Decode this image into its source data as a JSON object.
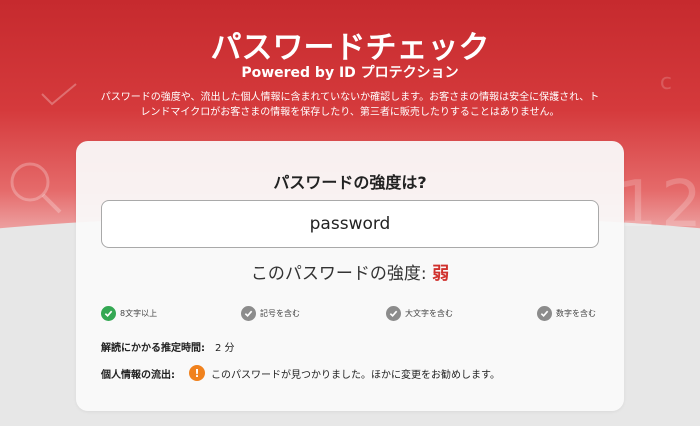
{
  "page": {
    "title": "パスワードチェック",
    "subtitle": "Powered by ID プロテクション",
    "description": "パスワードの強度や、流出した個人情報に含まれていないか確認します。お客さまの情報は安全に保護され、トレンドマイクロがお客さまの情報を保存したり、第三者に販売したりすることはありません。"
  },
  "decorations": {
    "letter": "c",
    "digits": "12"
  },
  "checker": {
    "question": "パスワードの強度は?",
    "password_value": "password",
    "strength_label": "このパスワードの強度: ",
    "strength_value": "弱",
    "strength_color": "#d0312d"
  },
  "criteria": [
    {
      "label": "8文字以上",
      "met": true,
      "icon": "check-icon"
    },
    {
      "label": "記号を含む",
      "met": false,
      "icon": "check-icon"
    },
    {
      "label": "大文字を含む",
      "met": false,
      "icon": "check-icon"
    },
    {
      "label": "数字を含む",
      "met": false,
      "icon": "check-icon"
    }
  ],
  "crack_time": {
    "label": "解読にかかる推定時間:",
    "value": "2 分"
  },
  "leak": {
    "label": "個人情報の流出:",
    "icon": "warning-icon",
    "message": "このパスワードが見つかりました。ほかに変更をお勧めします。"
  },
  "colors": {
    "brand_red": "#c62a2e",
    "ok_green": "#34a853",
    "neutral_gray": "#8c8c8c",
    "warning_orange": "#f0821e"
  }
}
